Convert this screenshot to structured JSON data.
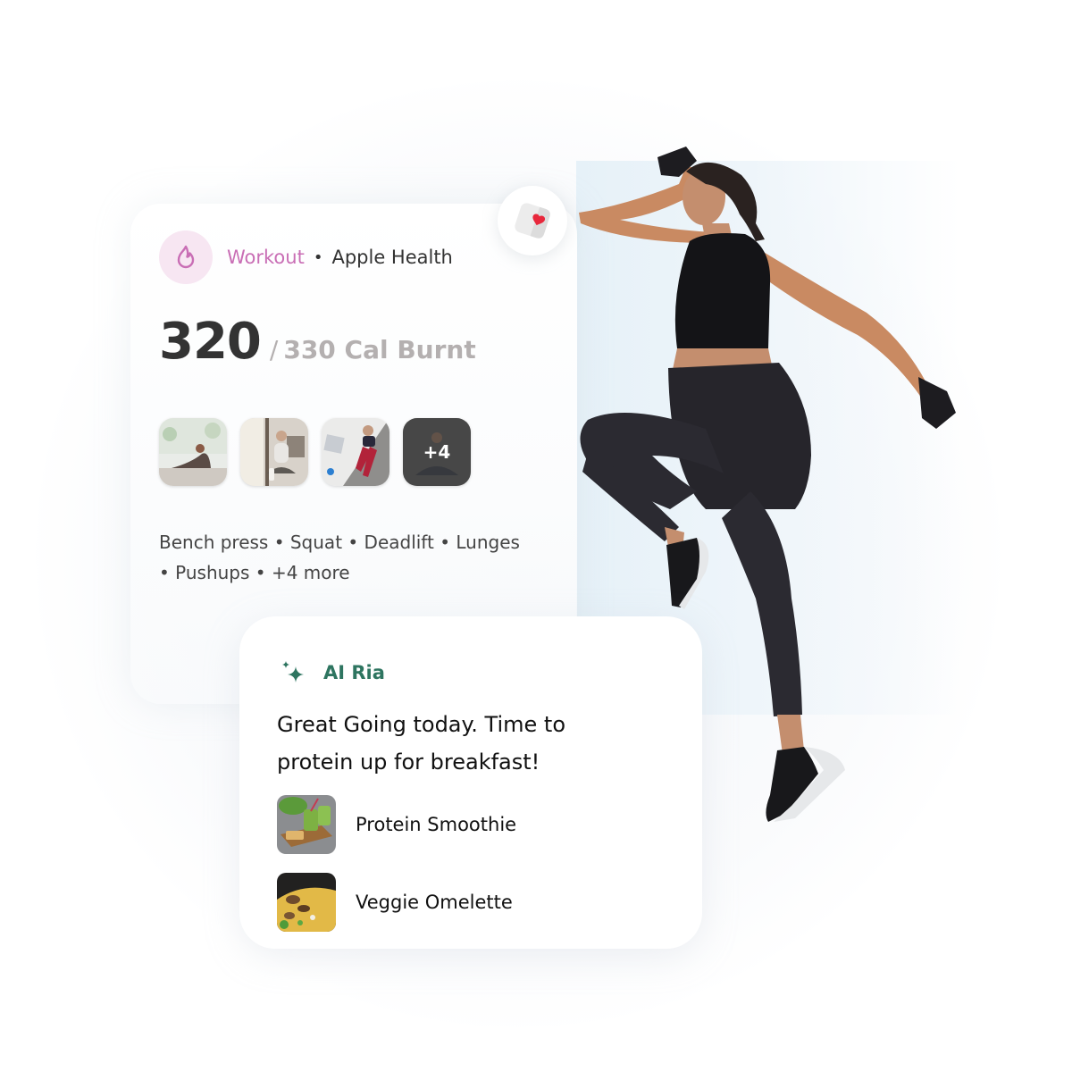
{
  "workout_card": {
    "category": "Workout",
    "separator": "•",
    "source": "Apple Health",
    "calories_burnt": "320",
    "calories_goal": "330 Cal Burnt",
    "slash": "/",
    "thumbnails": [
      {
        "label": "yoga-cobra-pose"
      },
      {
        "label": "meditation-by-window"
      },
      {
        "label": "crunches-on-mat"
      },
      {
        "label": "meditation-more",
        "overlay": "+4"
      }
    ],
    "exercises_line1": "Bench press • Squat • Deadlift • Lunges",
    "exercises_line2": "• Pushups • +4 more",
    "icons": {
      "category": "flame-icon",
      "source": "apple-health-icon"
    },
    "colors": {
      "category": "#c96eb5",
      "badge_bg": "#f7e6f2",
      "heart": "#e8283c"
    }
  },
  "ai_card": {
    "name": "AI Ria",
    "icon": "sparkles-icon",
    "message_line1": "Great Going today. Time to",
    "message_line2": "protein up for breakfast!",
    "suggestions": [
      {
        "name": "Protein Smoothie"
      },
      {
        "name": "Veggie Omelette"
      }
    ],
    "colors": {
      "accent": "#2e7560"
    }
  }
}
